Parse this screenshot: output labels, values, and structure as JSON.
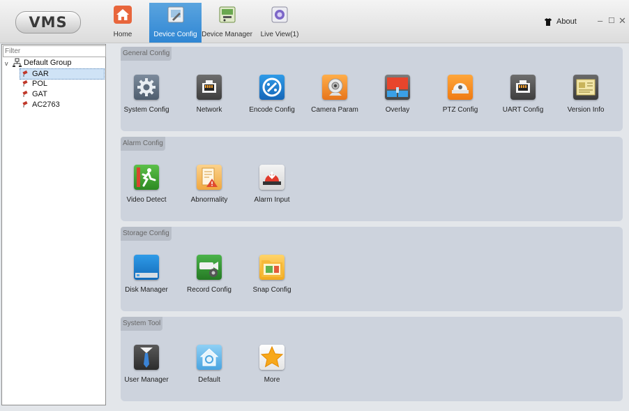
{
  "app": {
    "logo": "VMS"
  },
  "nav": {
    "tabs": [
      {
        "label": "Home",
        "icon": "home-icon"
      },
      {
        "label": "Device Config",
        "icon": "device-config-icon",
        "active": true
      },
      {
        "label": "Device Manager",
        "icon": "device-manager-icon"
      },
      {
        "label": "Live View(1)",
        "icon": "live-view-icon"
      }
    ],
    "about": "About",
    "window": {
      "minimize": "–",
      "maximize": "☐",
      "close": "✕"
    }
  },
  "sidebar": {
    "filter_placeholder": "Filter",
    "root": {
      "label": "Default Group",
      "expander": "v"
    },
    "devices": [
      {
        "label": "GAR",
        "selected": true
      },
      {
        "label": "POL"
      },
      {
        "label": "GAT"
      },
      {
        "label": "AC2763"
      }
    ]
  },
  "groups": [
    {
      "title": "General Config",
      "items": [
        {
          "label": "System Config",
          "icon": "gear-icon"
        },
        {
          "label": "Network",
          "icon": "network-port-icon"
        },
        {
          "label": "Encode Config",
          "icon": "encode-icon"
        },
        {
          "label": "Camera Param",
          "icon": "camera-icon"
        },
        {
          "label": "Overlay",
          "icon": "overlay-icon"
        },
        {
          "label": "PTZ Config",
          "icon": "ptz-dome-icon"
        },
        {
          "label": "UART Config",
          "icon": "uart-port-icon"
        },
        {
          "label": "Version Info",
          "icon": "version-info-icon"
        }
      ]
    },
    {
      "title": "Alarm Config",
      "items": [
        {
          "label": "Video Detect",
          "icon": "video-detect-icon"
        },
        {
          "label": "Abnormality",
          "icon": "abnormality-icon"
        },
        {
          "label": "Alarm Input",
          "icon": "alarm-input-icon"
        }
      ]
    },
    {
      "title": "Storage Config",
      "items": [
        {
          "label": "Disk Manager",
          "icon": "disk-icon"
        },
        {
          "label": "Record Config",
          "icon": "record-config-icon"
        },
        {
          "label": "Snap Config",
          "icon": "snap-folder-icon"
        }
      ]
    },
    {
      "title": "System Tool",
      "items": [
        {
          "label": "User Manager",
          "icon": "user-manager-icon"
        },
        {
          "label": "Default",
          "icon": "default-home-icon"
        },
        {
          "label": "More",
          "icon": "star-icon"
        }
      ]
    }
  ],
  "colors": {
    "active_tab": "#3a8fd8",
    "group_bg": "#cdd3dd",
    "selected_node": "#cfe3f6"
  }
}
